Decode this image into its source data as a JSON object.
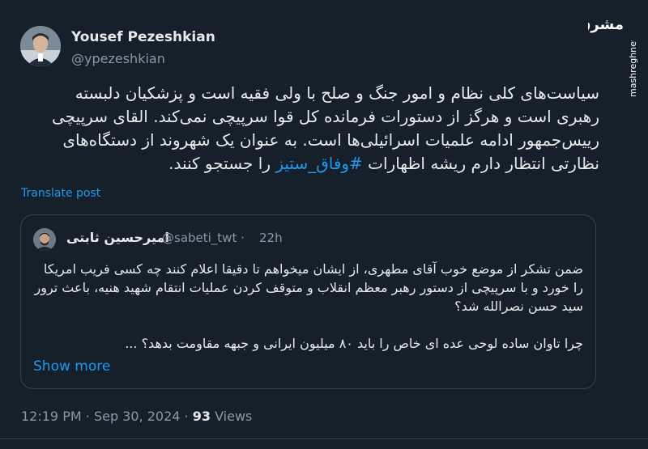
{
  "author": {
    "display_name": "Yousef Pezeshkian",
    "handle": "@ypezeshkian"
  },
  "post": {
    "text_main": "سیاست‌های کلی نظام و امور جنگ و صلح با ولی فقیه است و پزشکیان دلبسته رهبری است و هرگز از دستورات فرمانده کل قوا سرپیچی نمی‌کند. القای سرپیچی رییس‌جمهور ادامه علمیات اسرائیلی‌ها است. به عنوان یک شهروند از دستگاه‌های نظارتی انتظار دارم ریشه اظهارات",
    "hashtag": "#وفاق_ستیز",
    "text_tail": "را جستجو کنند.",
    "translate_label": "Translate post"
  },
  "quote": {
    "display_name": "امیرحسین ثابتی",
    "handle": "@sabeti_twt",
    "separator": "·",
    "time": "22h",
    "paragraph1": "ضمن تشکر از موضع خوب آقای مطهری، از ایشان میخواهم تا دقیقا اعلام کنند چه کسی فریب امریکا را خورد و با سرپیچی از دستور رهبر معظم انقلاب و متوقف کردن عملیات انتقام شهید هنیه، باعث ترور سید حسن نصرالله شد؟",
    "paragraph2": "چرا تاوان ساده لوحی عده ای خاص را باید ۸۰ میلیون ایرانی و جبهه مقاومت بدهد؟ ...",
    "show_more_label": "Show more"
  },
  "meta": {
    "time": "12:19 PM",
    "sep1": "·",
    "date": "Sep 30, 2024",
    "sep2": "·",
    "views_count": "93",
    "views_label": "Views"
  },
  "watermark": {
    "logo_text": "مشرق",
    "site_text": "mashreghnews.ir"
  },
  "colors": {
    "background": "#15202b",
    "text": "#e7e9ea",
    "secondary": "#8b98a5",
    "accent": "#1d9bf0",
    "border": "#38444d"
  }
}
